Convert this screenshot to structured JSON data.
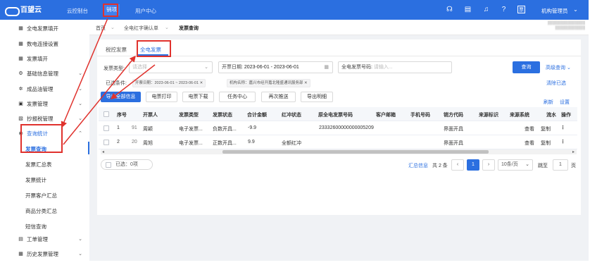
{
  "topbar": {
    "brand": "百望云",
    "nav": [
      "云控制台",
      "销项",
      "用户中心"
    ],
    "user": "机构管理员",
    "icons": [
      "headset-icon",
      "document-icon",
      "bell-icon",
      "help-icon",
      "invoice-icon"
    ]
  },
  "sidebar": {
    "items": [
      {
        "label": "全电发票填开",
        "icon": "grid-icon"
      },
      {
        "label": "数电连接设置",
        "icon": "grid-icon"
      },
      {
        "label": "发票填开",
        "icon": "grid-icon"
      },
      {
        "label": "基础信息管理",
        "icon": "gear-icon"
      },
      {
        "label": "成品油管理",
        "icon": "gear-icon"
      },
      {
        "label": "发票管理",
        "icon": "gear-icon"
      },
      {
        "label": "抄报税管理",
        "icon": "gear-icon"
      },
      {
        "label": "查询统计",
        "icon": "search-icon"
      }
    ],
    "sub_items": [
      "发票查询",
      "发票汇总表",
      "发票统计",
      "开票客户汇总",
      "商品分类汇总",
      "短信查询"
    ],
    "bottom_items": [
      {
        "label": "工单管理",
        "icon": "ticket-icon"
      },
      {
        "label": "历史发票管理",
        "icon": "grid-icon"
      }
    ]
  },
  "breadcrumb": {
    "items": [
      "首页",
      "全电红字确认单",
      "发票查询"
    ]
  },
  "tabs": [
    "税控发票",
    "全电发票"
  ],
  "filters": {
    "type_label": "发票类型:",
    "type_placeholder": "请选择",
    "date_label": "开票日期:",
    "date_value": "2023-06-01 - 2023-06-01",
    "number_label": "全电发票号码:",
    "number_placeholder": "请输入...",
    "search_button": "查询",
    "advanced_search": "高级查询",
    "selected_label": "已选条件:",
    "tags": [
      "开票日期：2023-06-01 ~ 2023-06-01",
      "机构名称：嘉兴市经开嘉北隆盛通讯服务部"
    ],
    "clear": "清除已选"
  },
  "toolbar": {
    "buttons": [
      "导出全部信息",
      "电票打印",
      "电票下载",
      "任务中心",
      "再次推送",
      "导出明细"
    ],
    "refresh": "刷新",
    "settings": "设置"
  },
  "table": {
    "headers": [
      "序号",
      "开票人",
      "发票类型",
      "发票状态",
      "合计金额",
      "红冲状态",
      "原全电发票号码",
      "客户邮箱",
      "手机号码",
      "销方代码",
      "来源标识",
      "来源系统",
      "流水",
      "操作"
    ],
    "rows": [
      {
        "seq": "1",
        "code": "91",
        "drawer": "周颖",
        "type": "电子发票...",
        "status": "负数开具...",
        "amount": "-9.9",
        "red": "",
        "orig": "23332600000000005209",
        "source": "界面开具",
        "actions": [
          "查看",
          "复制"
        ]
      },
      {
        "seq": "2",
        "code": "20",
        "drawer": "周旭",
        "type": "电子发票...",
        "status": "正数开具...",
        "amount": "9.9",
        "red": "全额红冲",
        "orig": "",
        "source": "界面开具",
        "actions": [
          "查看",
          "复制"
        ]
      }
    ]
  },
  "footer": {
    "selected": "已选：0项",
    "summary": "汇总信息",
    "total": "共 2 条",
    "page": "1",
    "page_size": "10条/页",
    "jump_label": "跳至",
    "jump_value": "1",
    "page_unit": "页"
  },
  "colors": {
    "brand_blue": "#2b6fe0",
    "annotation_red": "#e0322d"
  }
}
